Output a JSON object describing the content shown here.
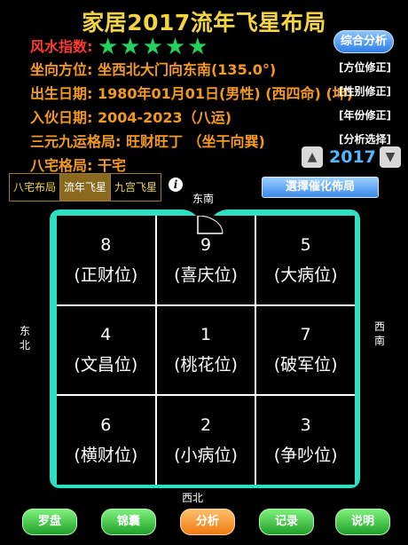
{
  "title": "家居2017流年飞星布局",
  "fengshui": {
    "label": "风水指数:",
    "stars": "★★★★★"
  },
  "header_button": "综合分析",
  "rows": [
    {
      "label": "坐向方位:",
      "value": "坐西北大门向东南(135.0°)",
      "link": "[方位修正]"
    },
    {
      "label": "出生日期:",
      "value": "1980年01月01日(男性) (西四命) (坤)",
      "link": "[性别修正]"
    },
    {
      "label": "入伙日期:",
      "value": "2004-2023（八运)",
      "link": "[年份修正]"
    },
    {
      "label": "三元九运格局:",
      "value": "旺财旺丁 （坐干向巽)",
      "link": "[分析选择]"
    },
    {
      "label": "八宅格局:",
      "value": "干宅"
    }
  ],
  "year": {
    "value": "2017",
    "up_icon": "triangle-up",
    "down_icon": "triangle-down"
  },
  "tabs": [
    "八宅布局",
    "流年飞星",
    "九宫飞星"
  ],
  "active_tab": "流年飞星",
  "info_icon": "i",
  "select_button": "選擇催化佈局",
  "directions": {
    "top": "东南",
    "bottom": "西北",
    "left": "东北",
    "right": "西南"
  },
  "grid": [
    {
      "num": "8",
      "name": "(正财位)"
    },
    {
      "num": "9",
      "name": "(喜庆位)"
    },
    {
      "num": "5",
      "name": "(大病位)"
    },
    {
      "num": "4",
      "name": "(文昌位)"
    },
    {
      "num": "1",
      "name": "(桃花位)"
    },
    {
      "num": "7",
      "name": "(破军位)"
    },
    {
      "num": "6",
      "name": "(横财位)"
    },
    {
      "num": "2",
      "name": "(小病位)"
    },
    {
      "num": "3",
      "name": "(争吵位)"
    }
  ],
  "bottom_buttons": [
    "罗盘",
    "锦囊",
    "分析",
    "记录",
    "说明"
  ],
  "colors": {
    "accent_yellow": "#f5d442",
    "accent_orange": "#f59a1a",
    "house_frame": "#2de0c4",
    "star_green": "#22d45a",
    "button_blue": "#2f7fe6"
  }
}
